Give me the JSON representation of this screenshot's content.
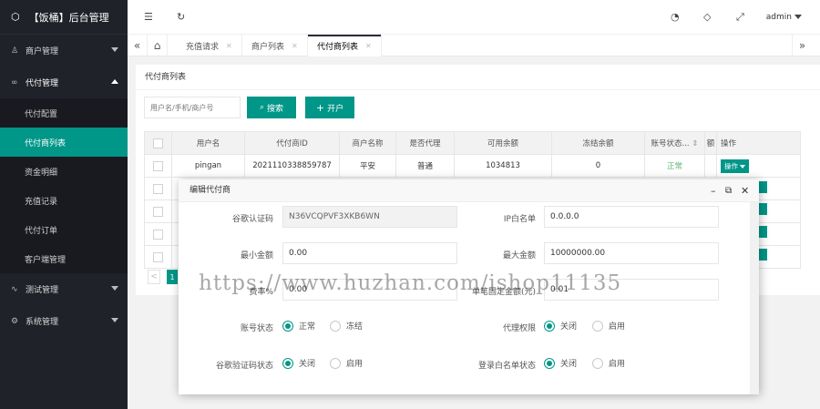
{
  "app": {
    "title": "【饭桶】后台管理"
  },
  "sidebar": {
    "groups": [
      {
        "label": "商户管理",
        "icon": "user-icon"
      },
      {
        "label": "代付管理",
        "icon": "link-icon",
        "open": true,
        "items": [
          "代付配置",
          "代付商列表",
          "资金明细",
          "充值记录",
          "代付订单",
          "客户端管理"
        ],
        "active": "代付商列表"
      },
      {
        "label": "测试管理",
        "icon": "pulse-icon"
      },
      {
        "label": "系统管理",
        "icon": "gear-icon"
      }
    ]
  },
  "header": {
    "user": "admin",
    "icons": [
      "shrink-menu-icon",
      "refresh-icon",
      "theme-icon",
      "tag-icon",
      "fullscreen-icon"
    ]
  },
  "tabs": [
    {
      "label": "充值请求"
    },
    {
      "label": "商户列表"
    },
    {
      "label": "代付商列表",
      "active": true
    }
  ],
  "page": {
    "title": "代付商列表",
    "search_placeholder": "用户名/手机/商户号",
    "search_label": "搜索",
    "open_label": "开户"
  },
  "table": {
    "columns": [
      "用户名",
      "代付商ID",
      "商户名称",
      "是否代理",
      "可用余额",
      "冻结余额",
      "账号状态...",
      "额",
      "操作"
    ],
    "rows": [
      {
        "username": "pingan",
        "id": "2021110338859787",
        "name": "平安",
        "agent": "普通",
        "balance": "1034813",
        "frozen": "0",
        "status": "正常",
        "op": "操作"
      }
    ]
  },
  "pager": {
    "prev": "<",
    "current": "1"
  },
  "modal": {
    "title": "编辑代付商",
    "fields": {
      "google_code_label": "谷歌认证码",
      "google_code_value": "N36VCQPVF3XKB6WN",
      "ip_label": "IP白名单",
      "ip_value": "0.0.0.0",
      "min_label": "最小金额",
      "min_value": "0.00",
      "max_label": "最大金额",
      "max_value": "10000000.00",
      "rate_label": "费率%",
      "rate_value": "0.00",
      "fixed_label": "单笔固定金额(元)",
      "fixed_value": "0.01"
    },
    "radios": {
      "acct_label": "账号状态",
      "acct_on": "正常",
      "acct_off": "冻结",
      "proxy_label": "代理权限",
      "proxy_on": "关闭",
      "proxy_off": "启用",
      "gauth_label": "谷歌验证码状态",
      "gauth_on": "关闭",
      "gauth_off": "启用",
      "login_label": "登录白名单状态",
      "login_on": "关闭",
      "login_off": "启用"
    }
  },
  "watermark": "https://www.huzhan.com/ishop11135",
  "colors": {
    "accent": "#009688",
    "sidebar": "#20222a",
    "status_ok": "#5fb878"
  }
}
